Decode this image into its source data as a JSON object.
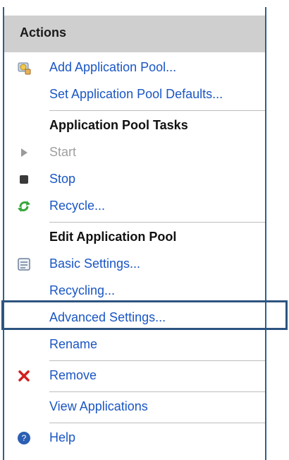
{
  "panel": {
    "title": "Actions",
    "items": [
      {
        "name": "add-application-pool",
        "label": "Add Application Pool...",
        "icon": "app-pool-add-icon"
      },
      {
        "name": "set-application-pool-defaults",
        "label": "Set Application Pool Defaults...",
        "icon": null
      }
    ],
    "sections": [
      {
        "title": "Application Pool Tasks",
        "items": [
          {
            "name": "start",
            "label": "Start",
            "icon": "play-icon",
            "disabled": true
          },
          {
            "name": "stop",
            "label": "Stop",
            "icon": "stop-icon"
          },
          {
            "name": "recycle",
            "label": "Recycle...",
            "icon": "recycle-icon"
          }
        ]
      },
      {
        "title": "Edit Application Pool",
        "items": [
          {
            "name": "basic-settings",
            "label": "Basic Settings...",
            "icon": "settings-icon"
          },
          {
            "name": "recycling",
            "label": "Recycling...",
            "icon": null
          },
          {
            "name": "advanced-settings",
            "label": "Advanced Settings...",
            "icon": null
          },
          {
            "name": "rename",
            "label": "Rename",
            "icon": null
          }
        ]
      }
    ],
    "bottom_items": [
      {
        "name": "remove",
        "label": "Remove",
        "icon": "remove-icon"
      },
      {
        "name": "view-applications",
        "label": "View Applications",
        "icon": null
      },
      {
        "name": "help",
        "label": "Help",
        "icon": "help-icon"
      }
    ]
  },
  "colors": {
    "link": "#1a56c4",
    "disabled": "#a0a0a0",
    "header_bg": "#cfcfcf",
    "highlight": "#2c5480",
    "remove": "#d21f1f",
    "recycle": "#37a73a",
    "help": "#2b5fb3"
  }
}
